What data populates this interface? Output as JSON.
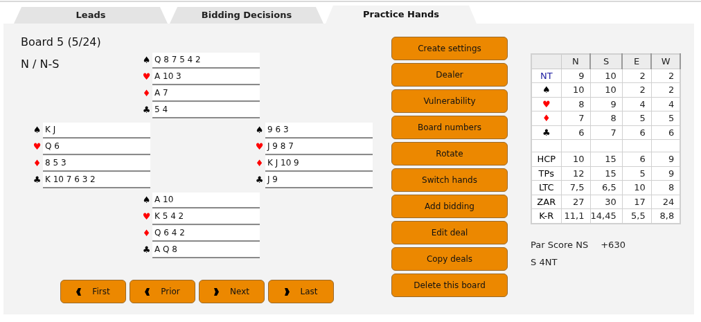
{
  "tabs": [
    {
      "label": "Leads",
      "selected": false
    },
    {
      "label": "Bidding Decisions",
      "selected": false
    },
    {
      "label": "Practice Hands",
      "selected": true
    }
  ],
  "board": {
    "title": "Board 5 (5/24)",
    "dealer_vulnerability": "N / N-S"
  },
  "hands": {
    "north": [
      {
        "suit": "♠",
        "color": "#000000",
        "cards": "Q 8 7 5 4 2"
      },
      {
        "suit": "♥",
        "color": "#ff0000",
        "cards": "A 10 3"
      },
      {
        "suit": "♦",
        "color": "#ff0000",
        "cards": "A 7"
      },
      {
        "suit": "♣",
        "color": "#000000",
        "cards": "5 4"
      }
    ],
    "west": [
      {
        "suit": "♠",
        "color": "#000000",
        "cards": "K J"
      },
      {
        "suit": "♥",
        "color": "#ff0000",
        "cards": "Q 6"
      },
      {
        "suit": "♦",
        "color": "#ff0000",
        "cards": "8 5 3"
      },
      {
        "suit": "♣",
        "color": "#000000",
        "cards": "K 10 7 6 3 2"
      }
    ],
    "east": [
      {
        "suit": "♠",
        "color": "#000000",
        "cards": "9 6 3"
      },
      {
        "suit": "♥",
        "color": "#ff0000",
        "cards": "J 9 8 7"
      },
      {
        "suit": "♦",
        "color": "#ff0000",
        "cards": "K J 10 9"
      },
      {
        "suit": "♣",
        "color": "#000000",
        "cards": "J 9"
      }
    ],
    "south": [
      {
        "suit": "♠",
        "color": "#000000",
        "cards": "A 10"
      },
      {
        "suit": "♥",
        "color": "#ff0000",
        "cards": "K 5 4 2"
      },
      {
        "suit": "♦",
        "color": "#ff0000",
        "cards": "Q 6 4 2"
      },
      {
        "suit": "♣",
        "color": "#000000",
        "cards": "A Q 8"
      }
    ]
  },
  "nav_buttons": [
    {
      "label": "First",
      "kind": "back"
    },
    {
      "label": "Prior",
      "kind": "back"
    },
    {
      "label": "Next",
      "kind": "forward"
    },
    {
      "label": "Last",
      "kind": "forward"
    }
  ],
  "action_buttons": [
    "Create settings",
    "Dealer",
    "Vulnerability",
    "Board numbers",
    "Rotate",
    "Switch hands",
    "Add bidding",
    "Edit deal",
    "Copy deals",
    "Delete this board"
  ],
  "table": {
    "columns": [
      "N",
      "S",
      "E",
      "W"
    ],
    "rows": [
      {
        "label": "NT",
        "color": "#1a1aa0",
        "values": [
          "9",
          "10",
          "2",
          "2"
        ]
      },
      {
        "label": "♠",
        "color": "#000000",
        "values": [
          "10",
          "10",
          "2",
          "2"
        ]
      },
      {
        "label": "♥",
        "color": "#ff0000",
        "values": [
          "8",
          "9",
          "4",
          "4"
        ]
      },
      {
        "label": "♦",
        "color": "#ff0000",
        "values": [
          "7",
          "8",
          "5",
          "5"
        ]
      },
      {
        "label": "♣",
        "color": "#000000",
        "values": [
          "6",
          "7",
          "6",
          "6"
        ]
      },
      {
        "kind": "blank"
      },
      {
        "label": "HCP",
        "color": "#000000",
        "values": [
          "10",
          "15",
          "6",
          "9"
        ]
      },
      {
        "label": "TPs",
        "color": "#000000",
        "values": [
          "12",
          "15",
          "5",
          "9"
        ]
      },
      {
        "label": "LTC",
        "color": "#000000",
        "values": [
          "7,5",
          "6,5",
          "10",
          "8"
        ]
      },
      {
        "label": "ZAR",
        "color": "#000000",
        "values": [
          "27",
          "30",
          "17",
          "24"
        ]
      },
      {
        "label": "K-R",
        "color": "#000000",
        "values": [
          "11,1",
          "14,45",
          "5,5",
          "8,8"
        ]
      }
    ]
  },
  "par": {
    "label": "Par Score NS",
    "score": "+630",
    "contract": "S 4NT"
  }
}
